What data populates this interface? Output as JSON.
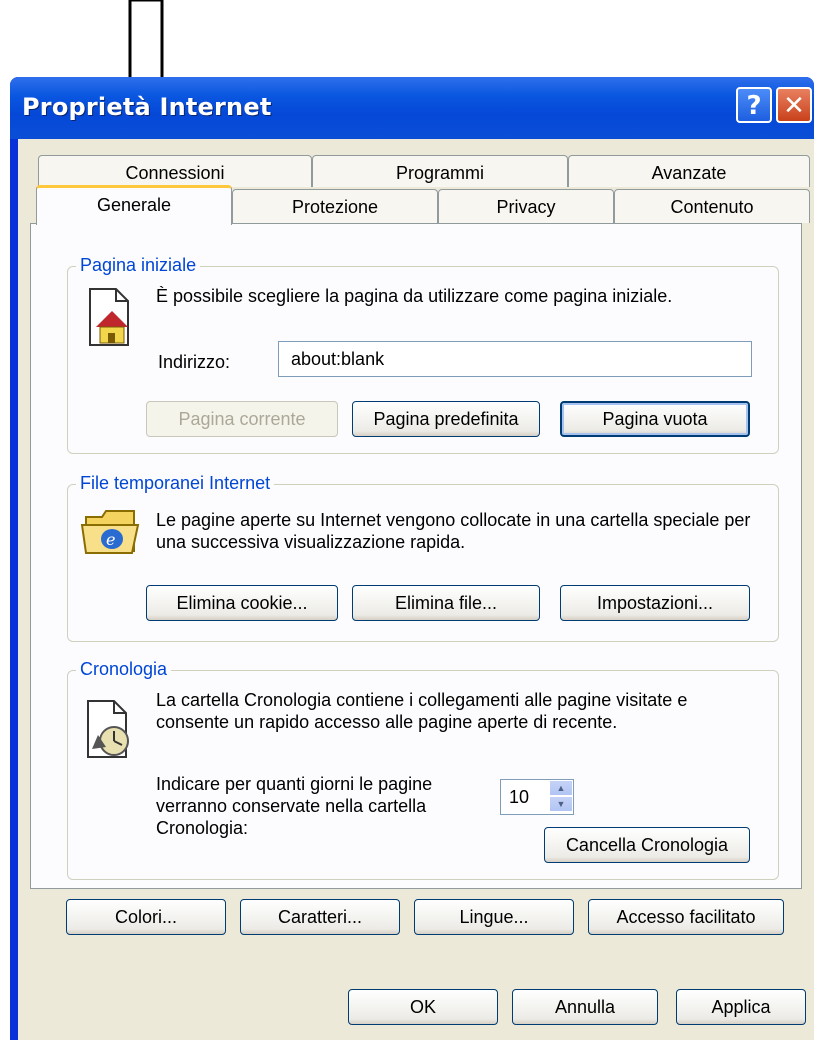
{
  "window": {
    "title": "Proprietà Internet",
    "help_label": "?",
    "close_label": "✕"
  },
  "tabs": {
    "row1": [
      "Connessioni",
      "Programmi",
      "Avanzate"
    ],
    "row2": [
      "Generale",
      "Protezione",
      "Privacy",
      "Contenuto"
    ],
    "active": "Generale"
  },
  "home_page": {
    "title": "Pagina iniziale",
    "description": "È possibile scegliere la pagina da utilizzare come pagina iniziale.",
    "address_label": "Indirizzo:",
    "address_value": "about:blank",
    "btn_current": "Pagina corrente",
    "btn_default": "Pagina predefinita",
    "btn_blank": "Pagina vuota"
  },
  "temp_files": {
    "title": "File temporanei Internet",
    "description": "Le pagine aperte su Internet vengono collocate in una cartella speciale per una successiva visualizzazione rapida.",
    "btn_cookies": "Elimina cookie...",
    "btn_files": "Elimina file...",
    "btn_settings": "Impostazioni..."
  },
  "history": {
    "title": "Cronologia",
    "description": "La cartella Cronologia contiene i collegamenti alle pagine visitate e consente un rapido accesso alle pagine aperte di recente.",
    "days_label": "Indicare per quanti giorni le pagine verranno conservate nella cartella Cronologia:",
    "days_value": "10",
    "btn_clear": "Cancella Cronologia"
  },
  "bottom_buttons": {
    "colors": "Colori...",
    "fonts": "Caratteri...",
    "languages": "Lingue...",
    "accessibility": "Accesso facilitato"
  },
  "dialog_buttons": {
    "ok": "OK",
    "cancel": "Annulla",
    "apply": "Applica"
  },
  "colors": {
    "titlebar": "#0548d8",
    "dialog_bg": "#ece9d8",
    "group_title": "#0046d5",
    "active_tab_accent": "#ffc83c"
  }
}
